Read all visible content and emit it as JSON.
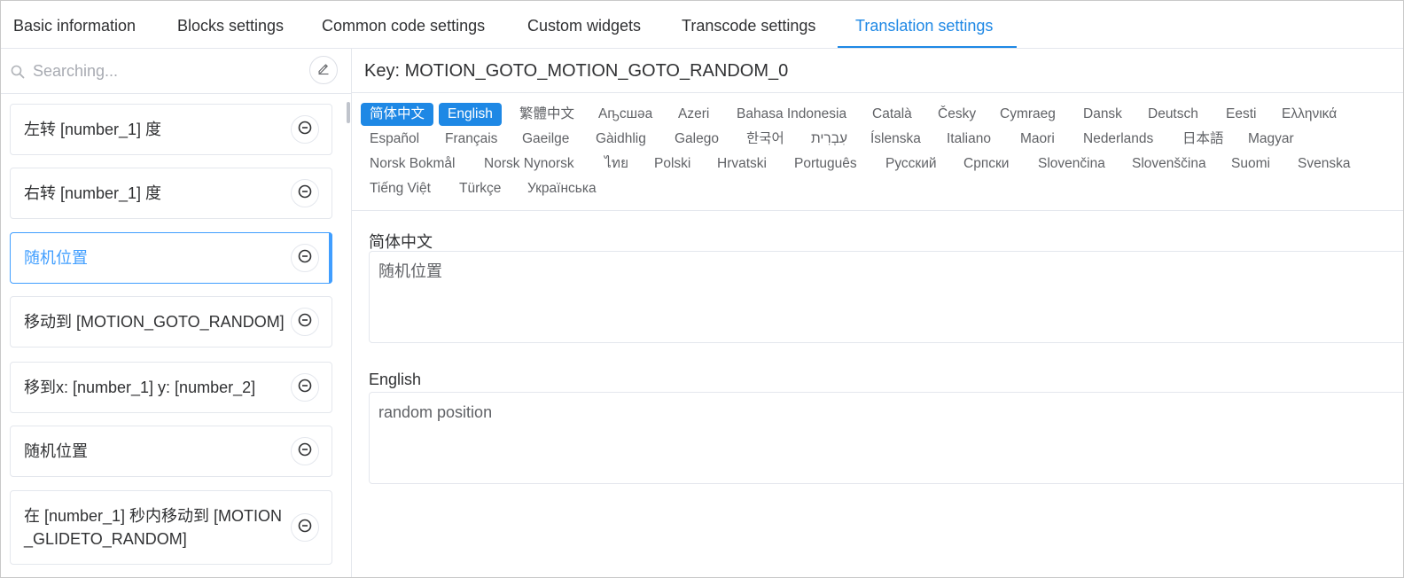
{
  "tabs": [
    {
      "label": "Basic information"
    },
    {
      "label": "Blocks settings"
    },
    {
      "label": "Common code settings"
    },
    {
      "label": "Custom widgets"
    },
    {
      "label": "Transcode settings"
    },
    {
      "label": "Translation settings"
    }
  ],
  "search": {
    "placeholder": "Searching...",
    "value": ""
  },
  "blocks": [
    {
      "label": "左转 [number_1] 度"
    },
    {
      "label": "右转 [number_1] 度"
    },
    {
      "label": "随机位置"
    },
    {
      "label": "移动到 [MOTION_GOTO_RANDOM]"
    },
    {
      "label": "移到x: [number_1] y: [number_2]"
    },
    {
      "label": "随机位置"
    },
    {
      "label": "在 [number_1] 秒内移动到 [MOTION_GLIDETO_RANDOM]"
    }
  ],
  "key": {
    "prefix": "Key: ",
    "value": "MOTION_GOTO_MOTION_GOTO_RANDOM_0"
  },
  "languages": [
    "简体中文",
    "English",
    "繁體中文",
    "Аҧсшәа",
    "Azeri",
    "Bahasa Indonesia",
    "Català",
    "Česky",
    "Cymraeg",
    "Dansk",
    "Deutsch",
    "Eesti",
    "Ελληνικά",
    "Español",
    "Français",
    "Gaeilge",
    "Gàidhlig",
    "Galego",
    "한국어",
    "עִבְרִית",
    "Íslenska",
    "Italiano",
    "Maori",
    "Nederlands",
    "日本語",
    "Magyar",
    "Norsk Bokmål",
    "Norsk Nynorsk",
    "ไทย",
    "Polski",
    "Hrvatski",
    "Português",
    "Русский",
    "Српски",
    "Slovenčina",
    "Slovenščina",
    "Suomi",
    "Svenska",
    "Tiếng Việt",
    "Türkçe",
    "Українська"
  ],
  "fields": [
    {
      "label": "简体中文",
      "value": "随机位置"
    },
    {
      "label": "English",
      "value": "random position"
    }
  ],
  "colors": {
    "accent": "#1e88e5",
    "active_item": "#409eff",
    "border": "#e4e7ed"
  },
  "icons": {
    "search": "search-icon",
    "edit": "edit-icon",
    "remove": "minus-circle-icon"
  }
}
